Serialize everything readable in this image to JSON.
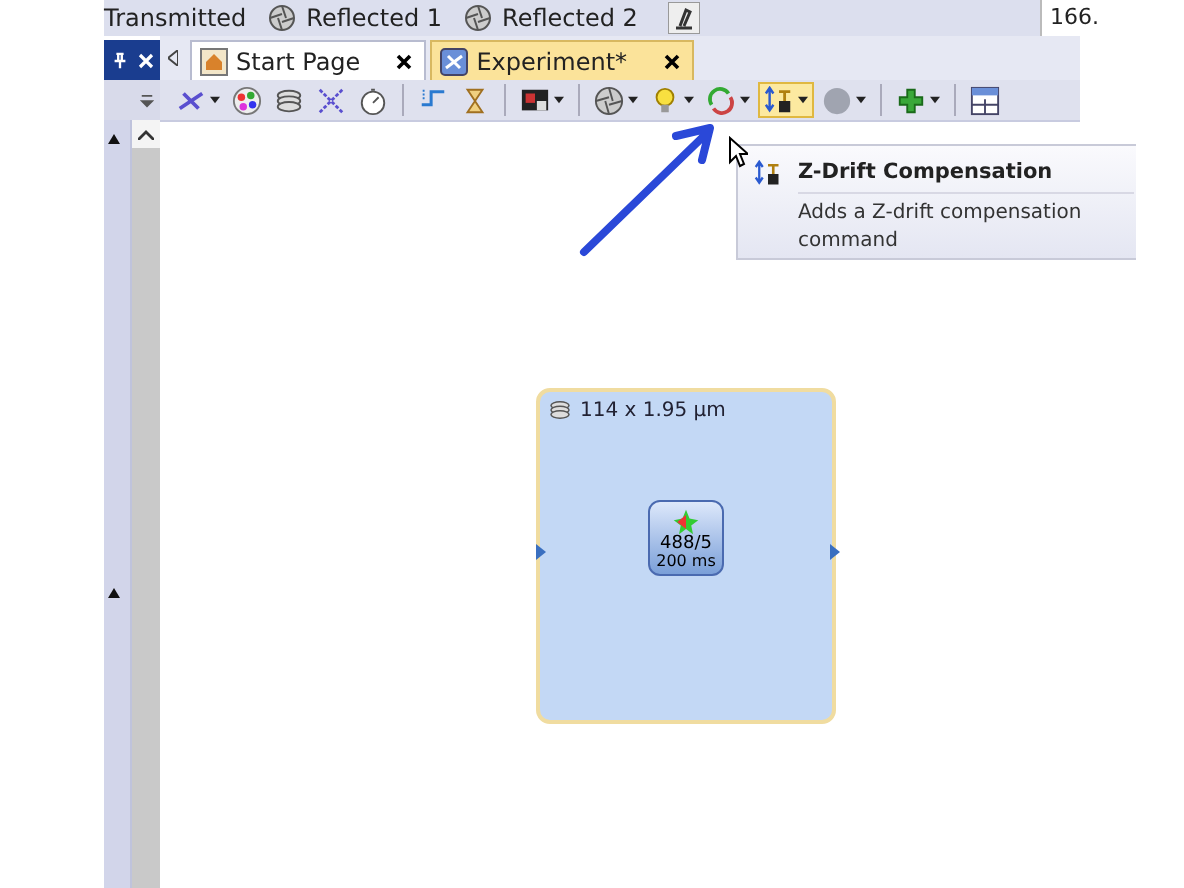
{
  "top_bar": {
    "channels": [
      {
        "label": "Transmitted",
        "icon": false
      },
      {
        "label": "Reflected 1",
        "icon": true
      },
      {
        "label": "Reflected 2",
        "icon": true
      }
    ],
    "field_value": "166."
  },
  "tabs": [
    {
      "label": "Start Page",
      "selected": false
    },
    {
      "label": "Experiment*",
      "selected": true
    }
  ],
  "toolbar": [
    {
      "kind": "channel",
      "dropdown": true,
      "selected": false
    },
    {
      "kind": "palette",
      "dropdown": false,
      "selected": false
    },
    {
      "kind": "stack",
      "dropdown": false,
      "selected": false
    },
    {
      "kind": "tiles",
      "dropdown": false,
      "selected": false
    },
    {
      "kind": "timer",
      "dropdown": false,
      "selected": false
    },
    {
      "kind": "separator"
    },
    {
      "kind": "step",
      "dropdown": false,
      "selected": false
    },
    {
      "kind": "hourglass",
      "dropdown": false,
      "selected": false
    },
    {
      "kind": "separator"
    },
    {
      "kind": "image",
      "dropdown": true,
      "selected": false
    },
    {
      "kind": "separator"
    },
    {
      "kind": "shutter",
      "dropdown": true,
      "selected": false
    },
    {
      "kind": "bulb",
      "dropdown": true,
      "selected": false
    },
    {
      "kind": "cycle",
      "dropdown": true,
      "selected": false
    },
    {
      "kind": "zdrift",
      "dropdown": true,
      "selected": true
    },
    {
      "kind": "circle",
      "dropdown": true,
      "selected": false
    },
    {
      "kind": "separator"
    },
    {
      "kind": "plus",
      "dropdown": true,
      "selected": false
    },
    {
      "kind": "separator"
    },
    {
      "kind": "layout",
      "dropdown": false,
      "selected": false
    }
  ],
  "tooltip": {
    "title": "Z-Drift Compensation",
    "text": "Adds a Z-drift compensation command"
  },
  "experiment_block": {
    "size": "114 x 1.95 µm",
    "node": {
      "line_1": "488/5",
      "line_2": "200 ms"
    }
  }
}
